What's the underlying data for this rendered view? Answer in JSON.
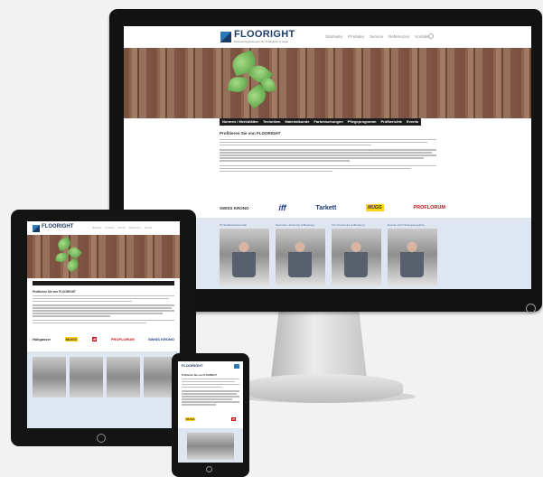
{
  "desktop": {
    "logo": "FLOORIGHT",
    "logo_sub": "Bodenbelagslösungen für Produktion & Lager",
    "nav": [
      "Startseite",
      "Produkte",
      "Service",
      "Referenzen",
      "Kontakt"
    ],
    "tabs": [
      "Normen / Merkblätter",
      "Techniken",
      "Materialkunde",
      "Farbmischungen",
      "Pflegeprogramm",
      "Prüfberichte",
      "Events"
    ],
    "intro_title": "Profitieren Sie von FLOORIGHT",
    "partners": [
      "SWISS KRONO",
      "iff",
      "Tarkett",
      "MUGG",
      "PROFLORUM"
    ],
    "cards": [
      "Ihr Wettbewerbsvorteil",
      "Seminare, Schulung & Beratung",
      "Vor-Ort-Service & Beratung",
      "Events und Trainingsangebote"
    ]
  },
  "tablet": {
    "logo": "FLOORIGHT",
    "nav": [
      "Startseite",
      "Produkte",
      "Service",
      "Referenzen",
      "Kontakt"
    ],
    "intro_title": "Profitieren Sie von FLOORIGHT",
    "partners": [
      "Hallgasser",
      "MUGG",
      "iff",
      "PROFLORUM",
      "SWISS KRONO"
    ]
  },
  "phone": {
    "logo": "FLOORIGHT",
    "intro_title": "Profitieren Sie von FLOORIGHT",
    "partners": [
      "MUGG",
      "iff"
    ]
  }
}
